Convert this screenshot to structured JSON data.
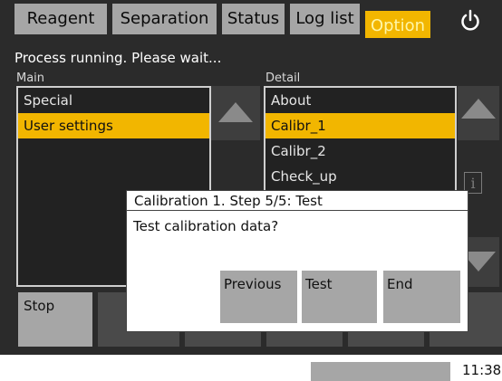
{
  "tabs": [
    {
      "label": "Reagent"
    },
    {
      "label": "Separation"
    },
    {
      "label": "Status"
    },
    {
      "label": "Log list"
    },
    {
      "label": "Option",
      "active": true
    }
  ],
  "status_message": "Process running. Please wait...",
  "main_panel": {
    "label": "Main",
    "items": [
      {
        "label": "Special"
      },
      {
        "label": "User settings",
        "selected": true
      }
    ]
  },
  "detail_panel": {
    "label": "Detail",
    "items": [
      {
        "label": "About"
      },
      {
        "label": "Calibr_1",
        "selected": true
      },
      {
        "label": "Calibr_2"
      },
      {
        "label": "Check_up"
      }
    ]
  },
  "bottom_buttons": {
    "stop_label": "Stop"
  },
  "dialog": {
    "title": "Calibration 1. Step 5/5: Test",
    "message": "Test calibration data?",
    "buttons": [
      "Previous",
      "Test",
      "End"
    ]
  },
  "clock": "11:38",
  "colors": {
    "accent": "#f2b600",
    "background": "#2b2b2b",
    "button": "#a6a6a6"
  },
  "icons": {
    "power": "power-icon",
    "info": "info-icon",
    "scroll_up": "arrow-up-icon",
    "scroll_down": "arrow-down-icon"
  }
}
